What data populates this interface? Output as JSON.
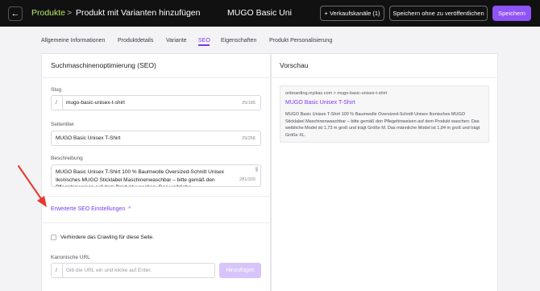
{
  "header": {
    "back_icon": "arrow-left-icon",
    "breadcrumb_root": "Produkte",
    "breadcrumb_separator": ">",
    "page_title": "Produkt mit Varianten hinzufügen",
    "product_name": "MUGO Basic Unisex",
    "channels_button": "+ Verkaufskanäle (1)",
    "save_draft_button": "Speichern ohne zu veröffentlichen",
    "save_button": "Speichern",
    "accent_color": "#8e54f5",
    "breadcrumb_color": "#b9e86a"
  },
  "tabs": [
    {
      "label": "Allgemeine Informationen",
      "active": false
    },
    {
      "label": "Produktdetails",
      "active": false
    },
    {
      "label": "Variante",
      "active": false
    },
    {
      "label": "SEO",
      "active": true
    },
    {
      "label": "Eigenschaften",
      "active": false
    },
    {
      "label": "Produkt Personalisierung",
      "active": false
    }
  ],
  "seo": {
    "title": "Suchmaschinenoptimierung (SEO)",
    "slug_label": "Slug",
    "slug_prefix": "/",
    "slug_value": "mugo-basic-unisex-t-shirt",
    "slug_counter": "25/185",
    "page_title_label": "Seitentitel",
    "page_title_value": "MUGO Basic Unisex T-Shirt",
    "page_title_counter": "25/256",
    "description_label": "Beschreibung",
    "description_value": "MUGO Basic Unisex T-Shirt 100 % Baumwolle Oversized-Schnitt Unisex Ikonisches MUGO Sticklabel Maschinenwaschbar – bitte gemäß den Pflegehinweisen auf dem Produkt waschen. Das weibliche",
    "description_counter": "281/320",
    "advanced_link": "Erweiterte SEO Einstellungen",
    "advanced_icon": "chevron-up-icon",
    "crawl_checkbox_label": "Verhindere das Crawling für diese Seite.",
    "crawl_checked": false,
    "canonical_label": "Kanonische URL",
    "canonical_prefix": "/",
    "canonical_placeholder": "Gib die URL ein und klicke auf Enter.",
    "canonical_add_button": "Hinzufügen"
  },
  "preview": {
    "title": "Vorschau",
    "url": "onboarding.myikas.com > mugo-basic-unisex-t-shirt",
    "page_title": "MUGO Basic Unisex T-Shirt",
    "description": "MUGO Basic Unisex T-Shirt 100 % Baumwolle Oversized-Schnitt Unisex Ikonisches MUGO Sticklabel Maschinenwaschbar – bitte gemäß den Pflegehinweisen auf dem Produkt waschen. Das weibliche Model ist 1,73 m groß und trägt Größe M. Das männliche Model ist 1,84 m groß und trägt Größe XL."
  },
  "annotation": {
    "arrow_color": "#e8372c"
  }
}
